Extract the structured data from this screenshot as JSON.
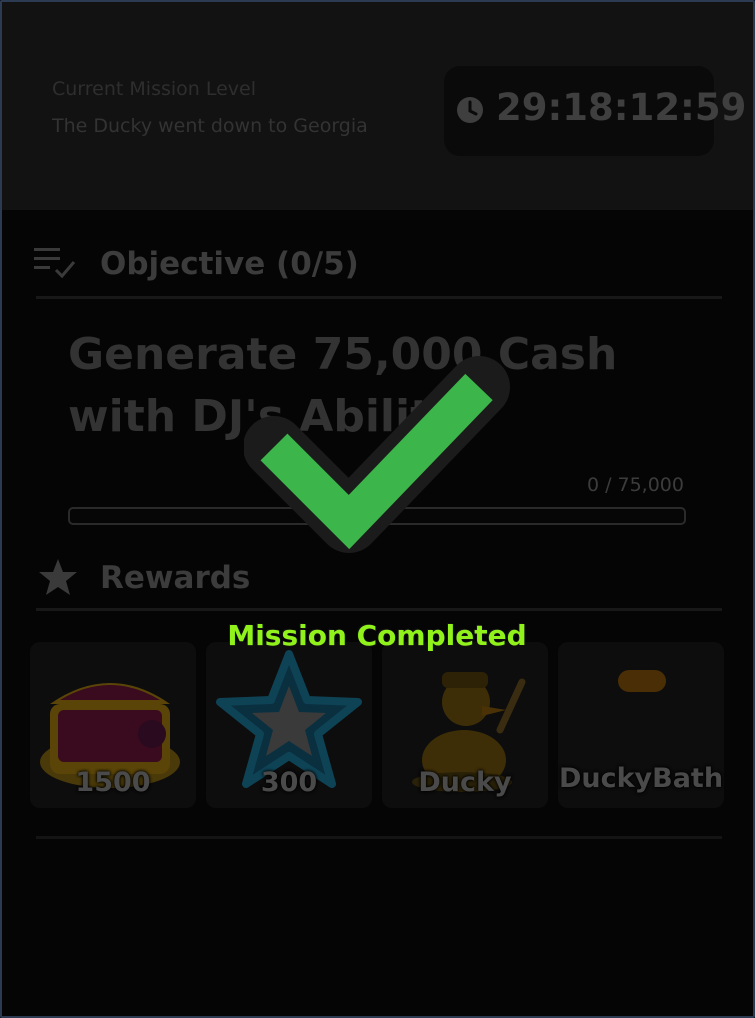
{
  "header": {
    "caption": "Current Mission Level",
    "mission_name": "The Ducky went down to Georgia",
    "timer": "29:18:12:59"
  },
  "objective": {
    "title": "Objective (0/5)",
    "text": "Generate 75,000 Cash with DJ's Ability",
    "progress_label": "0 / 75,000",
    "progress_current": 0,
    "progress_target": 75000
  },
  "rewards": {
    "title": "Rewards",
    "items": [
      {
        "label": "1500",
        "icon": "treasure-chest-icon"
      },
      {
        "label": "300",
        "icon": "star-icon"
      },
      {
        "label": "Ducky",
        "icon": "ducky-character-icon"
      },
      {
        "label": "DuckyBath",
        "icon": "ducky-bath-icon"
      }
    ]
  },
  "overlay": {
    "status": "Mission Completed",
    "icon": "checkmark-icon",
    "check_color": "#3cb54a",
    "status_color": "#90f21a"
  }
}
